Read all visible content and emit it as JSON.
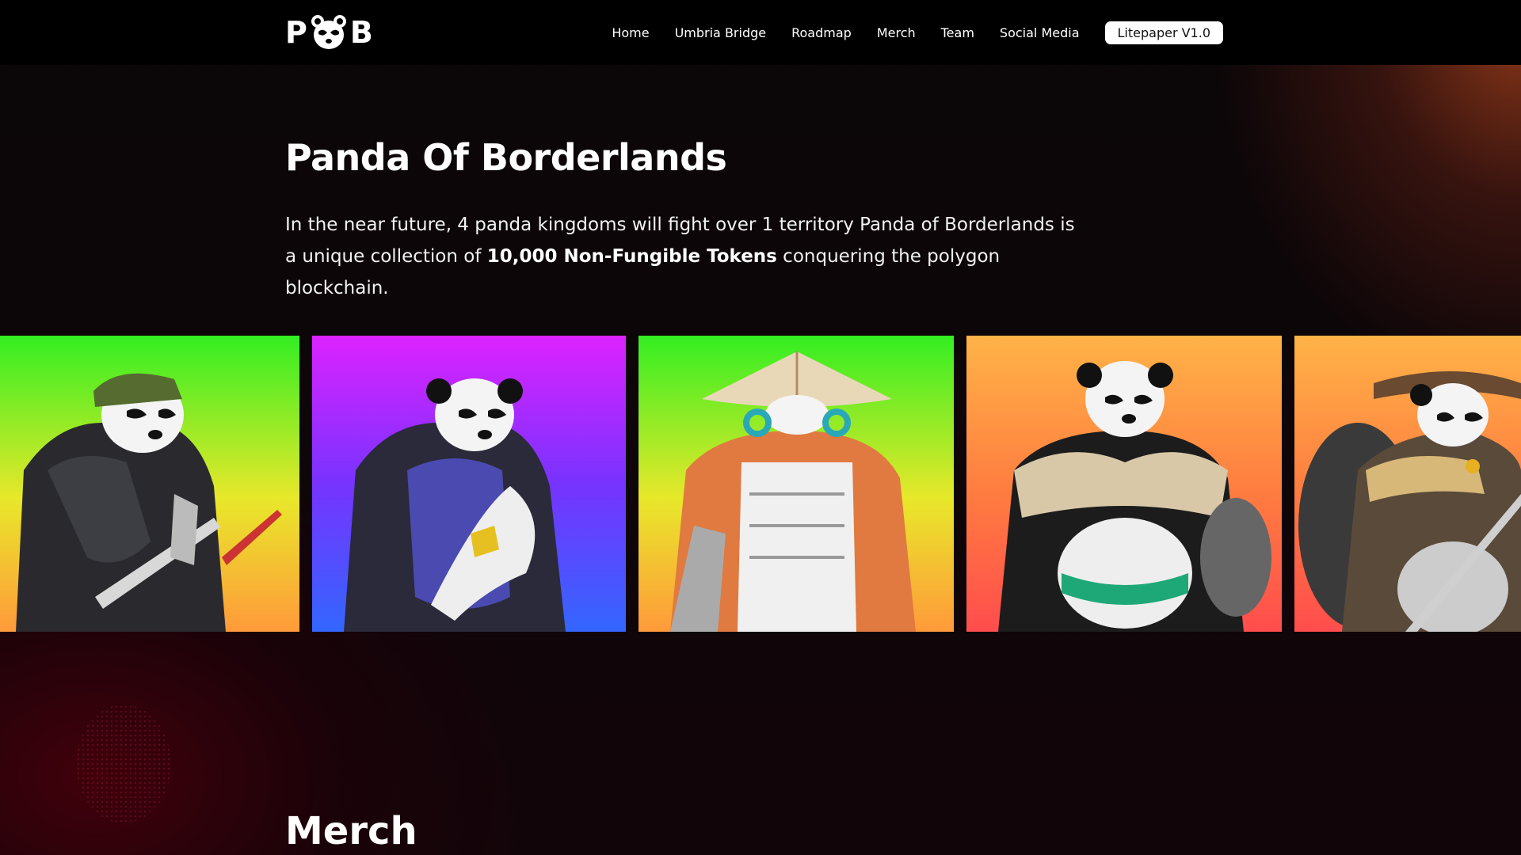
{
  "logo": {
    "left_letter": "P",
    "right_letter": "B",
    "icon": "panda-head-icon"
  },
  "nav": {
    "items": [
      {
        "label": "Home"
      },
      {
        "label": "Umbria Bridge"
      },
      {
        "label": "Roadmap"
      },
      {
        "label": "Merch"
      },
      {
        "label": "Team"
      },
      {
        "label": "Social Media"
      }
    ],
    "cta_label": "Litepaper V1.0"
  },
  "hero": {
    "title": "Panda Of Borderlands",
    "description_part1": "In the near future, 4 panda kingdoms will fight over 1 territory Panda of Borderlands is a unique collection of ",
    "description_bold": "10,000 Non-Fungible Tokens",
    "description_part2": " conquering the polygon blockchain."
  },
  "gallery": {
    "cards": [
      {
        "name": "panda-nft-green-cap",
        "bg_top": "#33ee22",
        "bg_mid": "#e8e82a",
        "bg_bottom": "#ff9a3a"
      },
      {
        "name": "panda-nft-purple-axe",
        "bg_top": "#dd22ff",
        "bg_mid": "#7733ff",
        "bg_bottom": "#3366ff"
      },
      {
        "name": "panda-nft-straw-hat",
        "bg_top": "#33ee22",
        "bg_mid": "#e8e82a",
        "bg_bottom": "#ff9a3a"
      },
      {
        "name": "panda-nft-fur-collar",
        "bg_top": "#ffb347",
        "bg_mid": "#ff7a40",
        "bg_bottom": "#ff4d4d"
      },
      {
        "name": "panda-nft-cowboy-hat",
        "bg_top": "#ffb347",
        "bg_mid": "#ff7a40",
        "bg_bottom": "#ff4d4d"
      }
    ]
  },
  "merch": {
    "title": "Merch"
  }
}
